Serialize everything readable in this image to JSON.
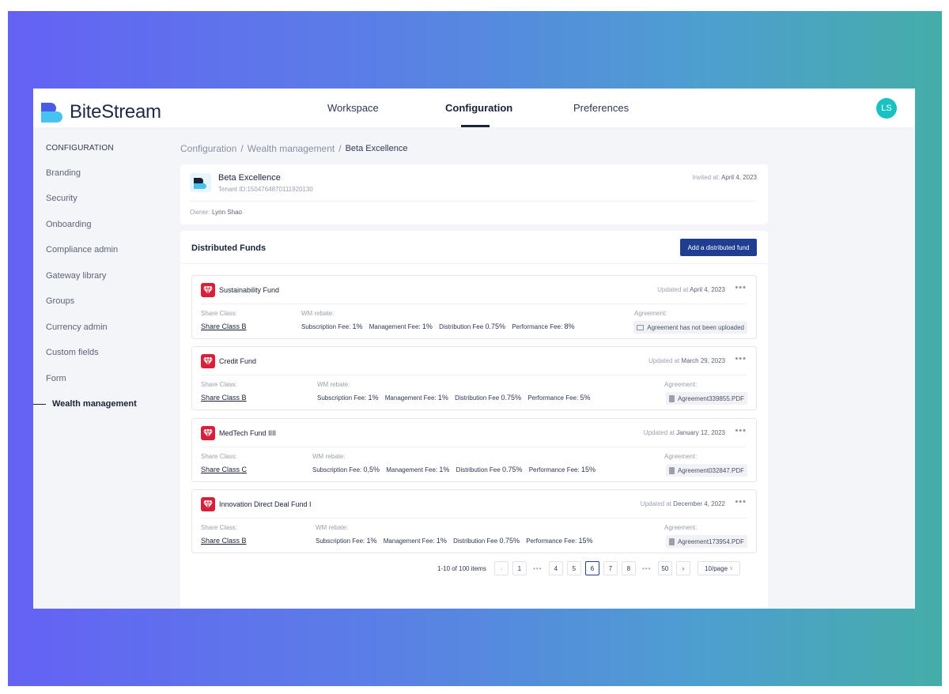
{
  "app": {
    "logo_text": "BiteStream",
    "user_initials": "LS",
    "accent_color": "#1f3e91",
    "avatar_color": "#19c2c0"
  },
  "nav": {
    "tabs": [
      {
        "label": "Workspace"
      },
      {
        "label": "Configuration"
      },
      {
        "label": "Preferences"
      }
    ],
    "active": "Configuration"
  },
  "sidebar": {
    "title": "CONFIGURATION",
    "items": [
      {
        "label": "Branding"
      },
      {
        "label": "Security"
      },
      {
        "label": "Onboarding"
      },
      {
        "label": "Compliance admin"
      },
      {
        "label": "Gateway library"
      },
      {
        "label": "Groups"
      },
      {
        "label": "Currency admin"
      },
      {
        "label": "Custom fields"
      },
      {
        "label": "Form"
      },
      {
        "label": "Wealth management"
      }
    ],
    "active": "Wealth management"
  },
  "breadcrumb": [
    "Configuration",
    "Wealth management",
    "Beta Excellence"
  ],
  "breadcrumb_separator": "/",
  "tenant": {
    "name": "Beta Excellence",
    "tenant_id": "Tenant ID:1504764870111920130",
    "invited_label": "Invited at:",
    "invited_value": "April 4, 2023",
    "owner_label": "Owner:",
    "owner_value": "Lynn Shao"
  },
  "funds_section": {
    "title": "Distributed Funds",
    "add_button": "Add a distributed fund",
    "labels": {
      "share_class": "Share Class:",
      "wm_rebate": "WM rebate:",
      "agreement": "Agreement:",
      "updated": "Updated at",
      "subscription": "Subscription Fee:",
      "management": "Management Fee:",
      "distribution": "Distribution Fee",
      "performance": "Performance Fee:"
    },
    "more_icon": "more-horizontal-icon",
    "funds": [
      {
        "name": "Sustainability Fund",
        "updated": "April 4, 2023",
        "share_class": "Share Class B",
        "subscription": "1%",
        "management": "1%",
        "distribution": "0.75%",
        "performance": "8%",
        "agreement": "Agreement has not been uploaded",
        "agreement_icon": "image-icon"
      },
      {
        "name": "Credit Fund",
        "updated": "March 29, 2023",
        "share_class": "Share Class B",
        "subscription": "1%",
        "management": "1%",
        "distribution": "0.75%",
        "performance": "5%",
        "agreement": "Agreement339855.PDF",
        "agreement_icon": "document-icon"
      },
      {
        "name": "MedTech Fund IIII",
        "updated": "January 12, 2023",
        "share_class": "Share Class C",
        "subscription": "0,5%",
        "management": "1%",
        "distribution": "0.75%",
        "performance": "15%",
        "agreement": "Agreement032847.PDF",
        "agreement_icon": "document-icon"
      },
      {
        "name": "Innovation Direct Deal Fund I",
        "updated": "December 4, 2022",
        "share_class": "Share Class B",
        "subscription": "1%",
        "management": "1%",
        "distribution": "0.75%",
        "performance": "15%",
        "agreement": "Agreement173954.PDF",
        "agreement_icon": "document-icon"
      }
    ]
  },
  "pagination": {
    "summary": "1-10 of 100 items",
    "prev": "‹",
    "next": "›",
    "ellipsis": "•••",
    "pages": [
      "1",
      "4",
      "5",
      "6",
      "7",
      "8",
      "50"
    ],
    "current": "6",
    "page_size": "10/page",
    "page_size_chevron": "v"
  }
}
